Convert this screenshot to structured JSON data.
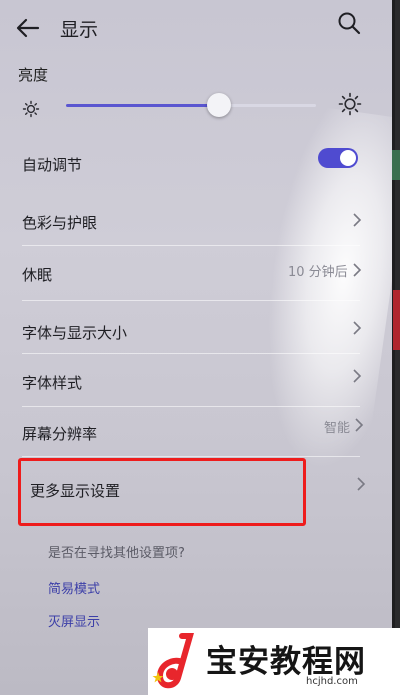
{
  "header": {
    "title": "显示",
    "back_icon": "arrow-left-icon",
    "search_icon": "search-icon"
  },
  "brightness": {
    "label": "亮度",
    "level_fraction": 0.61,
    "min_icon": "sun-small-icon",
    "max_icon": "sun-large-icon"
  },
  "rows": {
    "auto_adjust": {
      "label": "自动调节",
      "toggle_on": true
    },
    "color_eye": {
      "label": "色彩与护眼"
    },
    "sleep": {
      "label": "休眠",
      "value": "10 分钟后"
    },
    "font_display_size": {
      "label": "字体与显示大小"
    },
    "font_style": {
      "label": "字体样式"
    },
    "resolution": {
      "label": "屏幕分辨率",
      "value": "智能"
    },
    "more_settings": {
      "label": "更多显示设置"
    }
  },
  "suggestions": {
    "question": "是否在寻找其他设置项?",
    "links": [
      "简易模式",
      "灭屏显示"
    ]
  },
  "watermark": {
    "title": "宝安教程网",
    "url": "hcjhd.com"
  },
  "colors": {
    "accent": "#4f4bd0",
    "highlight_box": "#ee1c1c",
    "watermark_logo_red": "#e8262c"
  }
}
